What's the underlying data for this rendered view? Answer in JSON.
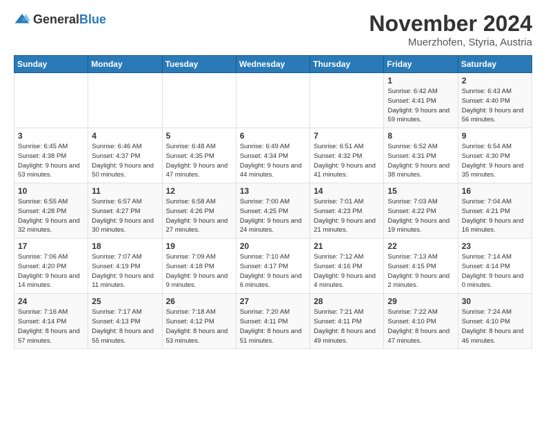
{
  "logo": {
    "text_general": "General",
    "text_blue": "Blue"
  },
  "title": "November 2024",
  "location": "Muerzhofen, Styria, Austria",
  "days_of_week": [
    "Sunday",
    "Monday",
    "Tuesday",
    "Wednesday",
    "Thursday",
    "Friday",
    "Saturday"
  ],
  "weeks": [
    [
      {
        "day": "",
        "detail": ""
      },
      {
        "day": "",
        "detail": ""
      },
      {
        "day": "",
        "detail": ""
      },
      {
        "day": "",
        "detail": ""
      },
      {
        "day": "",
        "detail": ""
      },
      {
        "day": "1",
        "detail": "Sunrise: 6:42 AM\nSunset: 4:41 PM\nDaylight: 9 hours and 59 minutes."
      },
      {
        "day": "2",
        "detail": "Sunrise: 6:43 AM\nSunset: 4:40 PM\nDaylight: 9 hours and 56 minutes."
      }
    ],
    [
      {
        "day": "3",
        "detail": "Sunrise: 6:45 AM\nSunset: 4:38 PM\nDaylight: 9 hours and 53 minutes."
      },
      {
        "day": "4",
        "detail": "Sunrise: 6:46 AM\nSunset: 4:37 PM\nDaylight: 9 hours and 50 minutes."
      },
      {
        "day": "5",
        "detail": "Sunrise: 6:48 AM\nSunset: 4:35 PM\nDaylight: 9 hours and 47 minutes."
      },
      {
        "day": "6",
        "detail": "Sunrise: 6:49 AM\nSunset: 4:34 PM\nDaylight: 9 hours and 44 minutes."
      },
      {
        "day": "7",
        "detail": "Sunrise: 6:51 AM\nSunset: 4:32 PM\nDaylight: 9 hours and 41 minutes."
      },
      {
        "day": "8",
        "detail": "Sunrise: 6:52 AM\nSunset: 4:31 PM\nDaylight: 9 hours and 38 minutes."
      },
      {
        "day": "9",
        "detail": "Sunrise: 6:54 AM\nSunset: 4:30 PM\nDaylight: 9 hours and 35 minutes."
      }
    ],
    [
      {
        "day": "10",
        "detail": "Sunrise: 6:55 AM\nSunset: 4:28 PM\nDaylight: 9 hours and 32 minutes."
      },
      {
        "day": "11",
        "detail": "Sunrise: 6:57 AM\nSunset: 4:27 PM\nDaylight: 9 hours and 30 minutes."
      },
      {
        "day": "12",
        "detail": "Sunrise: 6:58 AM\nSunset: 4:26 PM\nDaylight: 9 hours and 27 minutes."
      },
      {
        "day": "13",
        "detail": "Sunrise: 7:00 AM\nSunset: 4:25 PM\nDaylight: 9 hours and 24 minutes."
      },
      {
        "day": "14",
        "detail": "Sunrise: 7:01 AM\nSunset: 4:23 PM\nDaylight: 9 hours and 21 minutes."
      },
      {
        "day": "15",
        "detail": "Sunrise: 7:03 AM\nSunset: 4:22 PM\nDaylight: 9 hours and 19 minutes."
      },
      {
        "day": "16",
        "detail": "Sunrise: 7:04 AM\nSunset: 4:21 PM\nDaylight: 9 hours and 16 minutes."
      }
    ],
    [
      {
        "day": "17",
        "detail": "Sunrise: 7:06 AM\nSunset: 4:20 PM\nDaylight: 9 hours and 14 minutes."
      },
      {
        "day": "18",
        "detail": "Sunrise: 7:07 AM\nSunset: 4:19 PM\nDaylight: 9 hours and 11 minutes."
      },
      {
        "day": "19",
        "detail": "Sunrise: 7:09 AM\nSunset: 4:18 PM\nDaylight: 9 hours and 9 minutes."
      },
      {
        "day": "20",
        "detail": "Sunrise: 7:10 AM\nSunset: 4:17 PM\nDaylight: 9 hours and 6 minutes."
      },
      {
        "day": "21",
        "detail": "Sunrise: 7:12 AM\nSunset: 4:16 PM\nDaylight: 9 hours and 4 minutes."
      },
      {
        "day": "22",
        "detail": "Sunrise: 7:13 AM\nSunset: 4:15 PM\nDaylight: 9 hours and 2 minutes."
      },
      {
        "day": "23",
        "detail": "Sunrise: 7:14 AM\nSunset: 4:14 PM\nDaylight: 9 hours and 0 minutes."
      }
    ],
    [
      {
        "day": "24",
        "detail": "Sunrise: 7:16 AM\nSunset: 4:14 PM\nDaylight: 8 hours and 57 minutes."
      },
      {
        "day": "25",
        "detail": "Sunrise: 7:17 AM\nSunset: 4:13 PM\nDaylight: 8 hours and 55 minutes."
      },
      {
        "day": "26",
        "detail": "Sunrise: 7:18 AM\nSunset: 4:12 PM\nDaylight: 8 hours and 53 minutes."
      },
      {
        "day": "27",
        "detail": "Sunrise: 7:20 AM\nSunset: 4:11 PM\nDaylight: 8 hours and 51 minutes."
      },
      {
        "day": "28",
        "detail": "Sunrise: 7:21 AM\nSunset: 4:11 PM\nDaylight: 8 hours and 49 minutes."
      },
      {
        "day": "29",
        "detail": "Sunrise: 7:22 AM\nSunset: 4:10 PM\nDaylight: 8 hours and 47 minutes."
      },
      {
        "day": "30",
        "detail": "Sunrise: 7:24 AM\nSunset: 4:10 PM\nDaylight: 8 hours and 46 minutes."
      }
    ]
  ]
}
